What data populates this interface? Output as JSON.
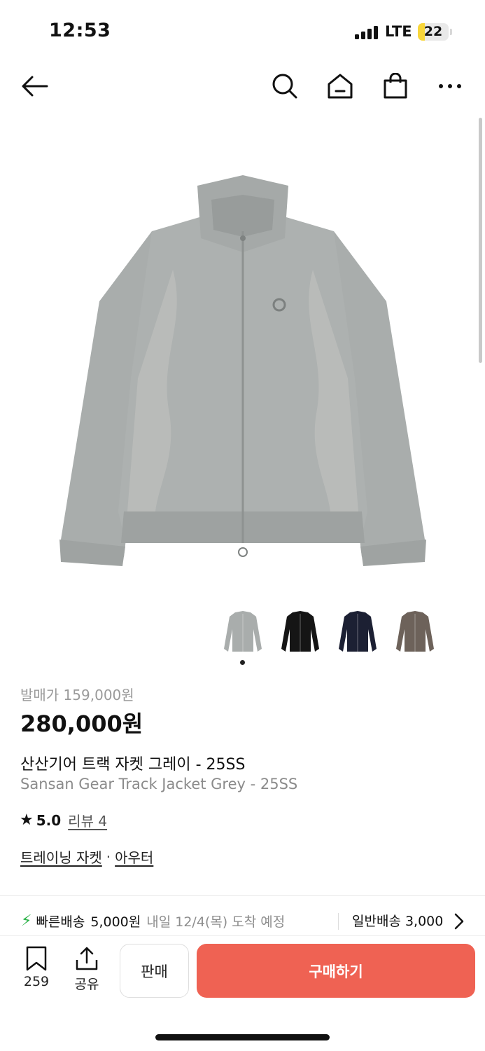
{
  "status_bar": {
    "time": "12:53",
    "network": "LTE",
    "battery_level": "22",
    "battery_percent": 22,
    "battery_color": "#f8d63a"
  },
  "nav": {
    "icons": [
      "back-arrow-icon",
      "search-icon",
      "home-icon",
      "shopping-bag-icon",
      "more-icon"
    ]
  },
  "product": {
    "image_icon": "grey-track-jacket",
    "thumbnails": [
      {
        "name": "grey",
        "color": "#a9adac"
      },
      {
        "name": "black",
        "color": "#151515"
      },
      {
        "name": "navy",
        "color": "#1c2033"
      },
      {
        "name": "brown",
        "color": "#6d625a"
      }
    ],
    "release_price": "발매가 159,000원",
    "price": "280,000원",
    "title_ko": "산산기어 트랙 자켓 그레이 - 25SS",
    "title_en": "Sansan Gear Track Jacket Grey - 25SS",
    "rating_score": "5.0",
    "review_link": "리뷰 4",
    "category_1": "트레이닝 자켓",
    "category_sep": "·",
    "category_2": "아우터"
  },
  "shipping": {
    "fast_label": "빠른배송",
    "fast_price": "5,000원",
    "fast_eta": "내일 12/4(목) 도착 예정",
    "normal": "일반배송 3,000",
    "accent": "#2db34a"
  },
  "bottom_bar": {
    "bookmark_count": "259",
    "share_label": "공유",
    "sell_label": "판매",
    "buy_label": "구매하기",
    "buy_color": "#ef6253"
  }
}
